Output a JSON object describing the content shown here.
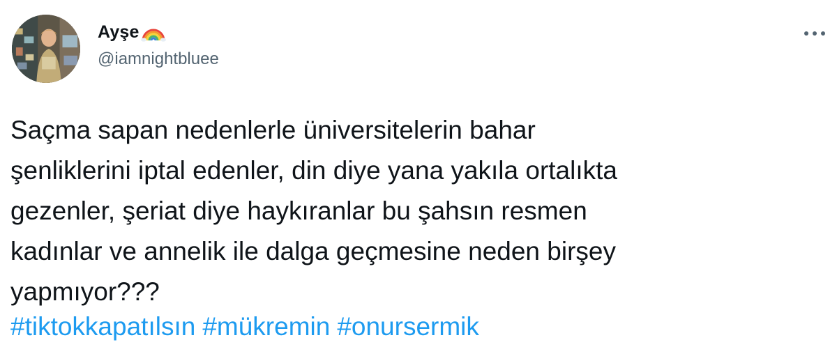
{
  "author": {
    "display_name": "Ayşe",
    "name_emoji": "rainbow-icon",
    "handle": "@iamnightbluee",
    "avatar": "profile-photo"
  },
  "tweet": {
    "text_lines": [
      "Saçma sapan nedenlerle üniversitelerin bahar",
      "şenliklerini iptal edenler, din diye yana yakıla ortalıkta",
      "gezenler, şeriat diye haykıranlar bu şahsın resmen",
      "kadınlar ve annelik ile dalga geçmesine neden birşey",
      "yapmıyor???"
    ],
    "hashtags": [
      "#tiktokkapatılsın",
      "#mükremin",
      "#onursermik"
    ]
  },
  "actions": {
    "more_icon": "more-options-icon"
  },
  "colors": {
    "text": "#0f1419",
    "secondary_text": "#536471",
    "link": "#1d9bf0",
    "background": "#ffffff"
  }
}
